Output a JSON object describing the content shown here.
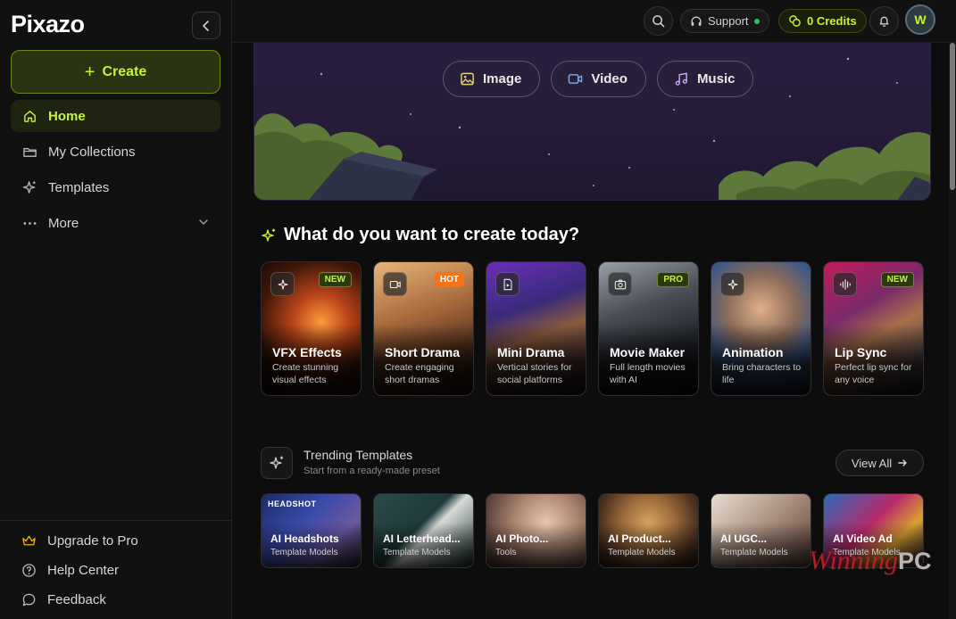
{
  "app": {
    "logo": "Pixazo"
  },
  "sidebar": {
    "create_label": "Create",
    "items": [
      {
        "label": "Home",
        "icon": "home-icon",
        "active": true
      },
      {
        "label": "My Collections",
        "icon": "folder-icon"
      },
      {
        "label": "Templates",
        "icon": "sparkles-icon"
      },
      {
        "label": "More",
        "icon": "dots-icon"
      }
    ],
    "bottom": [
      {
        "label": "Upgrade to Pro",
        "icon": "crown-icon"
      },
      {
        "label": "Help Center",
        "icon": "help-icon"
      },
      {
        "label": "Feedback",
        "icon": "chat-icon"
      }
    ]
  },
  "topbar": {
    "support_label": "Support",
    "credits_label": "0 Credits",
    "avatar_initial": "W"
  },
  "hero": {
    "buttons": [
      {
        "label": "Image",
        "icon": "image-icon"
      },
      {
        "label": "Video",
        "icon": "video-icon"
      },
      {
        "label": "Music",
        "icon": "music-icon"
      }
    ]
  },
  "create_section": {
    "title": "What do you want to create today?",
    "cards": [
      {
        "title": "VFX Effects",
        "desc": "Create stunning visual effects",
        "badge": "NEW",
        "icon": "sparkle-icon"
      },
      {
        "title": "Short Drama",
        "desc": "Create engaging short dramas",
        "badge": "HOT",
        "icon": "video-icon"
      },
      {
        "title": "Mini Drama",
        "desc": "Vertical stories for social platforms",
        "badge": "",
        "icon": "file-play-icon"
      },
      {
        "title": "Movie Maker",
        "desc": "Full length movies with AI",
        "badge": "PRO",
        "icon": "camera-icon"
      },
      {
        "title": "Animation",
        "desc": "Bring characters to life",
        "badge": "",
        "icon": "sparkle-icon"
      },
      {
        "title": "Lip Sync",
        "desc": "Perfect lip sync for any voice",
        "badge": "NEW",
        "icon": "waveform-icon"
      }
    ]
  },
  "trending": {
    "title": "Trending Templates",
    "subtitle": "Start from a ready-made preset",
    "view_all": "View All",
    "cards": [
      {
        "title": "AI Headshots",
        "sub": "Template Models",
        "overlay": "HEADSHOT"
      },
      {
        "title": "AI Letterhead...",
        "sub": "Template Models"
      },
      {
        "title": "AI Photo...",
        "sub": "Tools"
      },
      {
        "title": "AI Product...",
        "sub": "Template Models"
      },
      {
        "title": "AI UGC...",
        "sub": "Template Models"
      },
      {
        "title": "AI Video Ad",
        "sub": "Template Models"
      }
    ]
  },
  "watermark": {
    "script": "Winning",
    "suffix": "PC"
  },
  "colors": {
    "accent": "#c6f432",
    "hot": "#f97316",
    "bg": "#0d0d0d",
    "sidebar": "#111111"
  }
}
